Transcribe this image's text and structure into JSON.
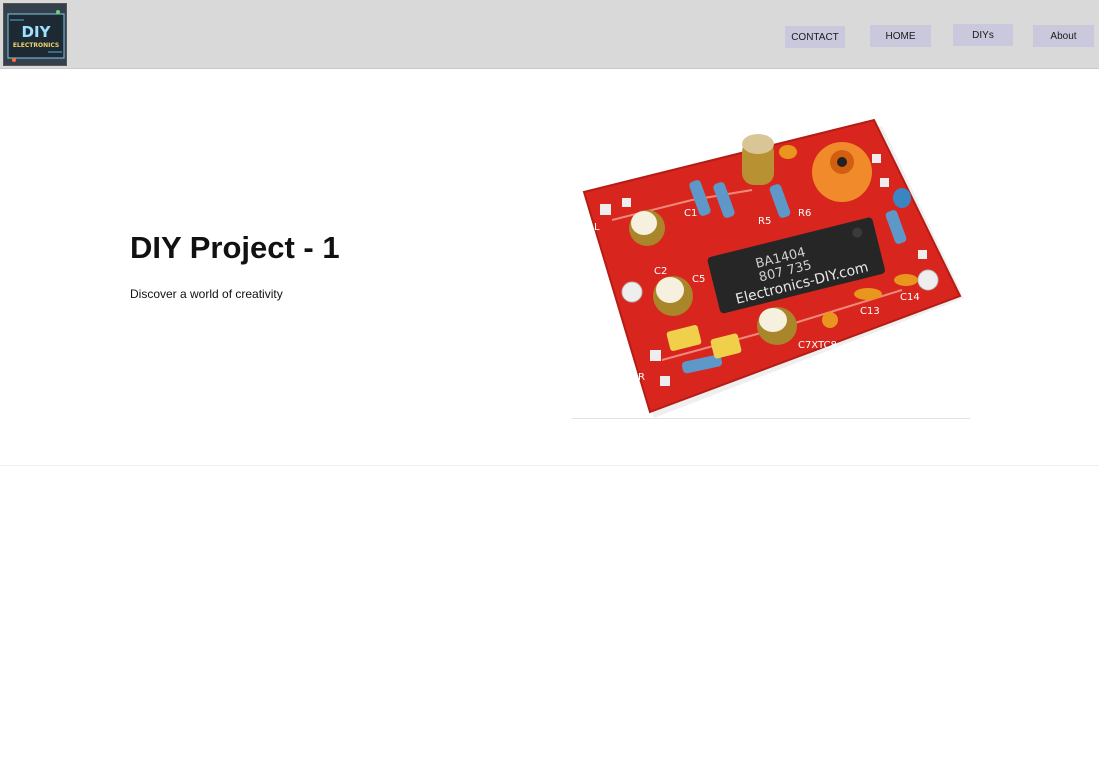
{
  "header": {
    "logo_text_top": "DIY",
    "logo_text_bottom": "ELECTRONICS",
    "nav": {
      "contact": "CONTACT",
      "home": "HOME",
      "diys": "DIYs",
      "about": "About"
    }
  },
  "hero": {
    "title": "DIY Project - 1",
    "subtitle": "Discover a world of creativity"
  },
  "pcb": {
    "chip_line1": "BA1404",
    "chip_line2": "807 735",
    "chip_watermark": "Electronics-DIY.com",
    "labels": [
      "C1",
      "C2",
      "C5",
      "R5",
      "R6",
      "C13",
      "C14",
      "C7XTC8",
      "L",
      "R"
    ]
  },
  "colors": {
    "header_bg": "#d9d9d9",
    "nav_button_bg": "#c9c8dc",
    "pcb_red": "#d8261f"
  }
}
